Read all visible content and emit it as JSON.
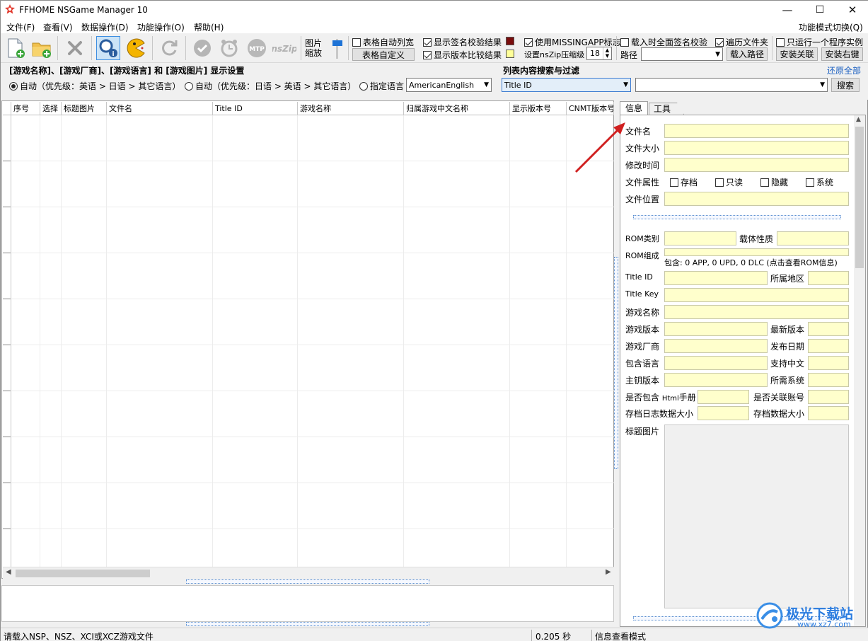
{
  "window": {
    "title": "FFHOME NSGame Manager 10",
    "minimize": "—",
    "maximize": "☐",
    "close": "✕"
  },
  "menu": {
    "items": [
      "文件(F)",
      "查看(V)",
      "数据操作(D)",
      "功能操作(O)",
      "帮助(H)"
    ],
    "right": "功能模式切换(Q)"
  },
  "toolbar": {
    "image_zoom": "图片\n缩放",
    "image_zoom_l1": "图片",
    "image_zoom_l2": "缩放",
    "auto_column": "表格自动列宽",
    "table_custom": "表格自定义",
    "show_sign": "显示签名校验结果",
    "show_version": "显示版本比较结果",
    "use_missing": "使用MISSINGAPP标志",
    "nszip_label": "设置nsZip压缩级",
    "nszip_value": "18",
    "full_sign": "载入时全面签名校验",
    "traverse": "遍历文件夹",
    "path_label": "路径",
    "load_path": "载入路径",
    "single_instance": "只运行一个程序实例",
    "install_assoc": "安装关联",
    "install_right": "安装右键",
    "sign_color": "#7a0c0c",
    "version_color": "#ffff99"
  },
  "display_settings": {
    "title": "[游戏名称]、[游戏厂商]、[游戏语言] 和 [游戏图片] 显示设置",
    "radio1": "自动（优先级：英语 > 日语 > 其它语言）",
    "radio2": "自动（优先级：日语 > 英语 > 其它语言）",
    "radio3": "指定语言",
    "language": "AmericanEnglish"
  },
  "search": {
    "title": "列表内容搜索与过滤",
    "restore": "还原全部",
    "field": "Title ID",
    "button": "搜索"
  },
  "table": {
    "columns": [
      "序号",
      "选择",
      "标题图片",
      "文件名",
      "Title ID",
      "游戏名称",
      "归属游戏中文名称",
      "显示版本号",
      "CNMT版本号"
    ]
  },
  "tabs": [
    "信息",
    "工具"
  ],
  "info": {
    "file_name": "文件名",
    "file_size": "文件大小",
    "mod_time": "修改时间",
    "file_attr": "文件属性",
    "attr_archive": "存档",
    "attr_readonly": "只读",
    "attr_hidden": "隐藏",
    "attr_system": "系统",
    "file_location": "文件位置",
    "rom_type": "ROM类别",
    "media": "载体性质",
    "rom_comp": "ROM组成",
    "rom_summary": "包含: 0 APP, 0 UPD, 0 DLC  (点击查看ROM信息)",
    "title_id": "Title ID",
    "region": "所属地区",
    "title_key": "Title Key",
    "game_name": "游戏名称",
    "game_version": "游戏版本",
    "latest_version": "最新版本",
    "publisher": "游戏厂商",
    "release_date": "发布日期",
    "languages": "包含语言",
    "chinese": "支持中文",
    "master_key": "主钥版本",
    "system": "所需系统",
    "html_manual_a": "是否包含 ",
    "html_manual_b": "Html",
    "html_manual_c": "手册",
    "linked_account": "是否关联账号",
    "save_log_size": "存档日志数据大小",
    "save_data_size": "存档数据大小",
    "title_image": "标题图片"
  },
  "status": {
    "message": "请载入NSP、NSZ、XCI或XCZ游戏文件",
    "time": "0.205 秒",
    "mode": "信息查看模式"
  },
  "watermark": {
    "text": "极光下载站",
    "url": "www.xz7.com"
  }
}
